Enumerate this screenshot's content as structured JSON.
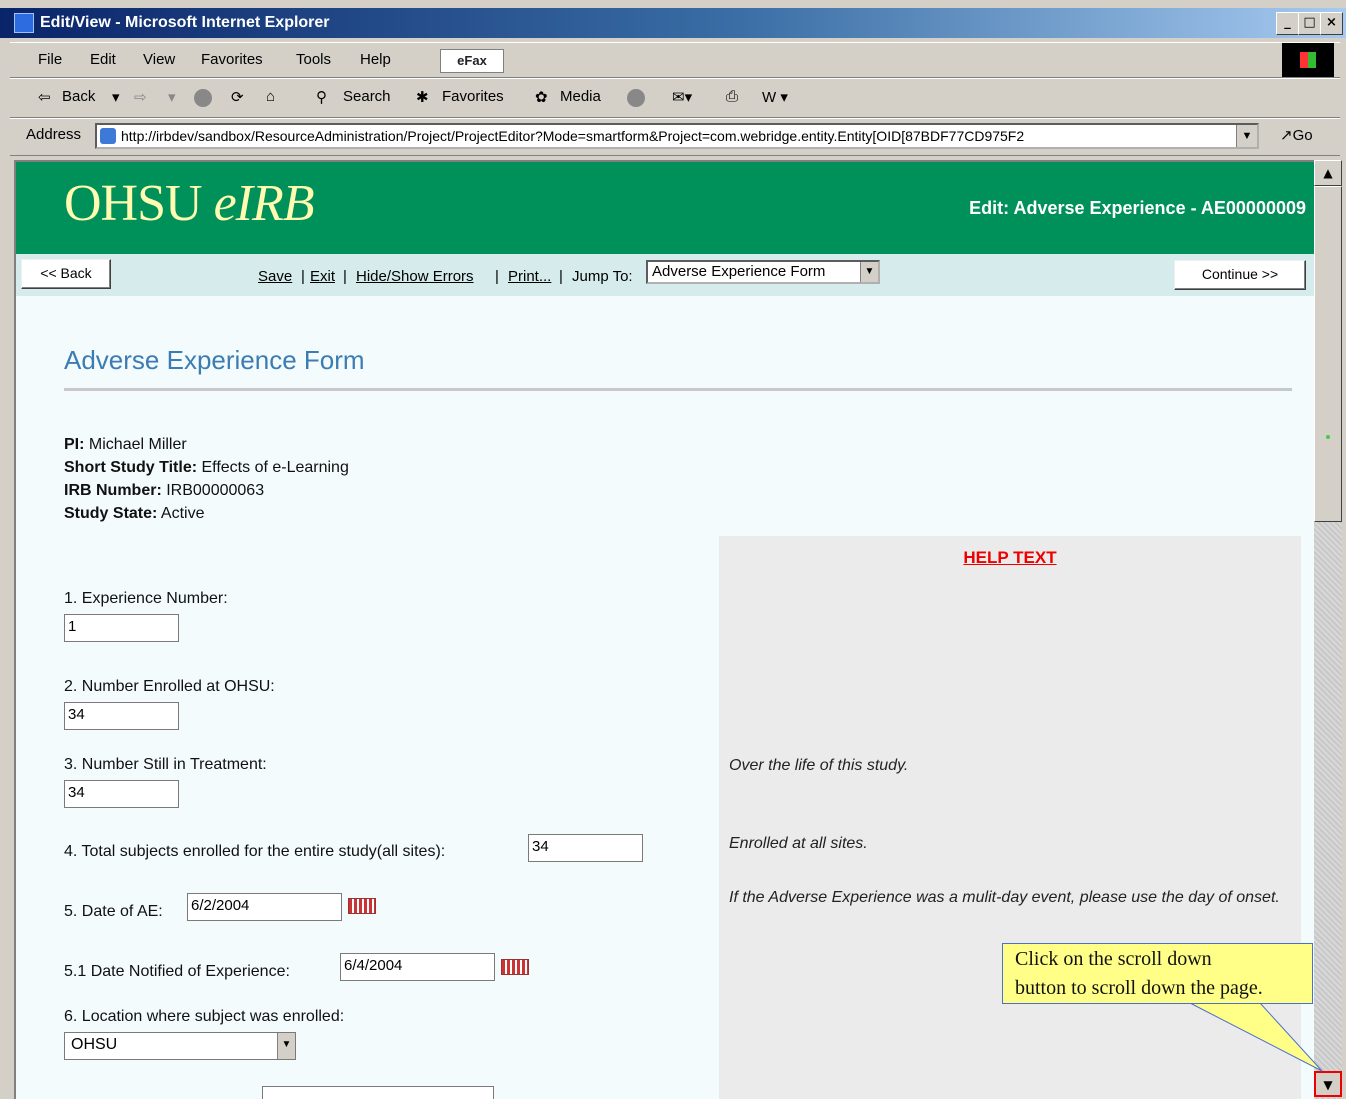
{
  "window": {
    "title": "Edit/View - Microsoft Internet Explorer",
    "controls": [
      "_",
      "□",
      "×"
    ]
  },
  "menu": [
    "File",
    "Edit",
    "View",
    "Favorites",
    "Tools",
    "Help"
  ],
  "efax_label": "eFax",
  "toolbar": {
    "back": "Back",
    "search": "Search",
    "favorites": "Favorites",
    "media": "Media"
  },
  "address": {
    "label": "Address",
    "url": "http://irbdev/sandbox/ResourceAdministration/Project/ProjectEditor?Mode=smartform&Project=com.webridge.entity.Entity[OID[87BDF77CD975F2",
    "go": "Go"
  },
  "header": {
    "logo_main": "OHSU",
    "logo_italic": "eIRB",
    "edit_title": "Edit: Adverse Experience - AE00000009"
  },
  "nav": {
    "back": "<< Back",
    "save": "Save",
    "exit": "Exit",
    "hide_show": "Hide/Show Errors",
    "print": "Print...",
    "jump_label": "Jump To:",
    "jump_value": "Adverse Experience Form",
    "continue": "Continue >>"
  },
  "form": {
    "title": "Adverse Experience Form",
    "pi_label": "PI:",
    "pi_value": "Michael  Miller",
    "study_label": "Short Study Title:",
    "study_value": "Effects of e-Learning",
    "irb_label": "IRB Number:",
    "irb_value": "IRB00000063",
    "state_label": "Study State:",
    "state_value": "Active",
    "q1": "1. Experience Number:",
    "q1_value": "1",
    "q2": "2. Number Enrolled at OHSU:",
    "q2_value": "34",
    "q3": "3. Number Still in Treatment:",
    "q3_value": "34",
    "q4": "4. Total subjects enrolled for the entire study(all sites):",
    "q4_value": "34",
    "q5": "5. Date of AE:",
    "q5_value": "6/2/2004",
    "q51": "5.1 Date Notified of Experience:",
    "q51_value": "6/4/2004",
    "q6": "6. Location where subject was enrolled:",
    "q6_value": "OHSU"
  },
  "help": {
    "title": "HELP TEXT",
    "h3": "Over the life of this study.",
    "h4": "Enrolled at all sites.",
    "h5": "If the Adverse Experience was a mulit-day event, please use the day of onset."
  },
  "callout": {
    "line1": "Click on the scroll down",
    "line2": "button to scroll down the page."
  }
}
